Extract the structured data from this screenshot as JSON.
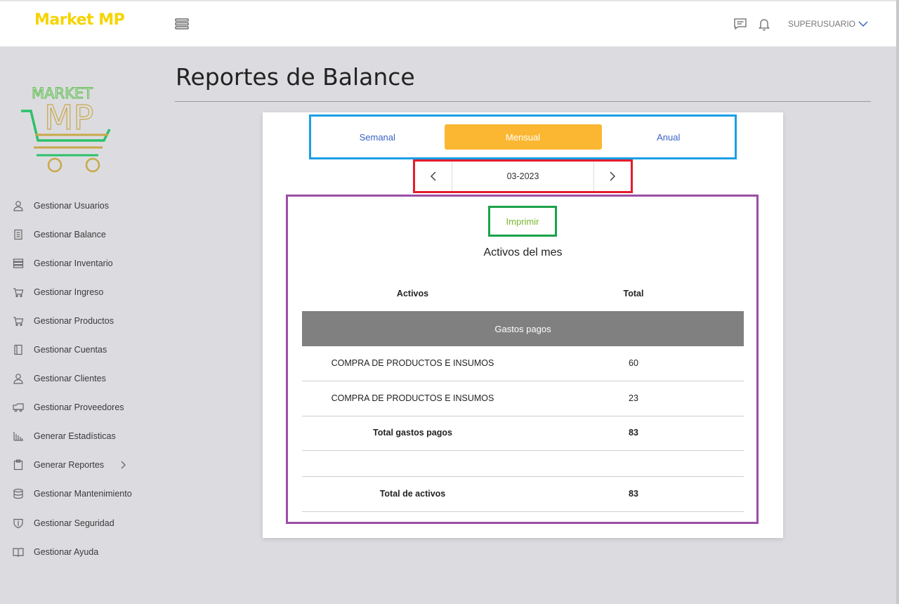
{
  "header": {
    "brand": "Market MP",
    "user_label": "SUPERUSUARIO",
    "icons": [
      "menu-icon",
      "chat-icon",
      "bell-icon",
      "chevron-down-icon"
    ]
  },
  "sidebar": {
    "logo_text_top": "MARKET",
    "logo_text_bottom": "MP",
    "items": [
      {
        "label": "Gestionar Usuarios",
        "icon": "user-icon"
      },
      {
        "label": "Gestionar Balance",
        "icon": "ledger-icon"
      },
      {
        "label": "Gestionar Inventario",
        "icon": "server-icon"
      },
      {
        "label": "Gestionar Ingreso",
        "icon": "cart-icon"
      },
      {
        "label": "Gestionar Productos",
        "icon": "cart-icon"
      },
      {
        "label": "Gestionar Cuentas",
        "icon": "book-icon"
      },
      {
        "label": "Gestionar Clientes",
        "icon": "user-icon"
      },
      {
        "label": "Gestionar Proveedores",
        "icon": "truck-icon"
      },
      {
        "label": "Generar Estadísticas",
        "icon": "bar-chart-icon"
      },
      {
        "label": "Generar Reportes",
        "icon": "clipboard-icon"
      },
      {
        "label": "Gestionar Mantenimiento",
        "icon": "database-icon"
      },
      {
        "label": "Gestionar Seguridad",
        "icon": "shield-icon"
      },
      {
        "label": "Gestionar Ayuda",
        "icon": "open-book-icon"
      }
    ]
  },
  "main": {
    "title": "Reportes de Balance",
    "tabs": [
      {
        "label": "Semanal",
        "active": false
      },
      {
        "label": "Mensual",
        "active": true
      },
      {
        "label": "Anual",
        "active": false
      }
    ],
    "period_value": "03-2023",
    "print_label": "Imprimir",
    "report_title": "Activos del mes",
    "table": {
      "headers": [
        "Activos",
        "Total"
      ],
      "section_label": "Gastos pagos",
      "rows": [
        {
          "label": "COMPRA DE PRODUCTOS E INSUMOS",
          "value": "60"
        },
        {
          "label": "COMPRA DE PRODUCTOS E INSUMOS",
          "value": "23"
        }
      ],
      "subtotal": {
        "label": "Total gastos pagos",
        "value": "83"
      },
      "total": {
        "label": "Total de activos",
        "value": "83"
      }
    }
  },
  "colors": {
    "brand": "#f6d400",
    "active_tab": "#fbb732",
    "tab_text": "#3a63c4",
    "print_text": "#77b72d",
    "section_bg": "#808080",
    "highlight_tabs": "#1a9fe6",
    "highlight_period": "#e31c2c",
    "highlight_print": "#1ca24a",
    "highlight_report": "#9b4ea4"
  }
}
